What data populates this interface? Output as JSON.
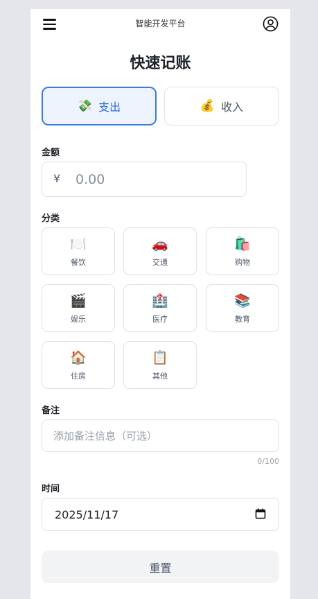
{
  "header": {
    "app_title": "智能开发平台",
    "menu_icon": "hamburger-menu-icon",
    "user_icon": "user-circle-icon"
  },
  "page": {
    "title": "快速记账"
  },
  "type_toggle": {
    "expense": {
      "emoji": "💸",
      "label": "支出",
      "active": true
    },
    "income": {
      "emoji": "💰",
      "label": "收入",
      "active": false
    }
  },
  "amount": {
    "label": "金额",
    "currency": "¥",
    "placeholder": "0.00",
    "value": ""
  },
  "category": {
    "label": "分类",
    "items": [
      {
        "emoji": "🍽️",
        "label": "餐饮"
      },
      {
        "emoji": "🚗",
        "label": "交通"
      },
      {
        "emoji": "🛍️",
        "label": "购物"
      },
      {
        "emoji": "🎬",
        "label": "娱乐"
      },
      {
        "emoji": "🏥",
        "label": "医疗"
      },
      {
        "emoji": "📚",
        "label": "教育"
      },
      {
        "emoji": "🏠",
        "label": "住房"
      },
      {
        "emoji": "📋",
        "label": "其他"
      }
    ]
  },
  "note": {
    "label": "备注",
    "placeholder": "添加备注信息（可选）",
    "counter": "0/100"
  },
  "time": {
    "label": "时间",
    "value": "2025/11/17",
    "icon": "calendar-icon"
  },
  "actions": {
    "reset_label": "重置"
  },
  "colors": {
    "accent": "#3a7be0",
    "accent_bg": "#eef4fe",
    "border": "#dfe1e6"
  }
}
